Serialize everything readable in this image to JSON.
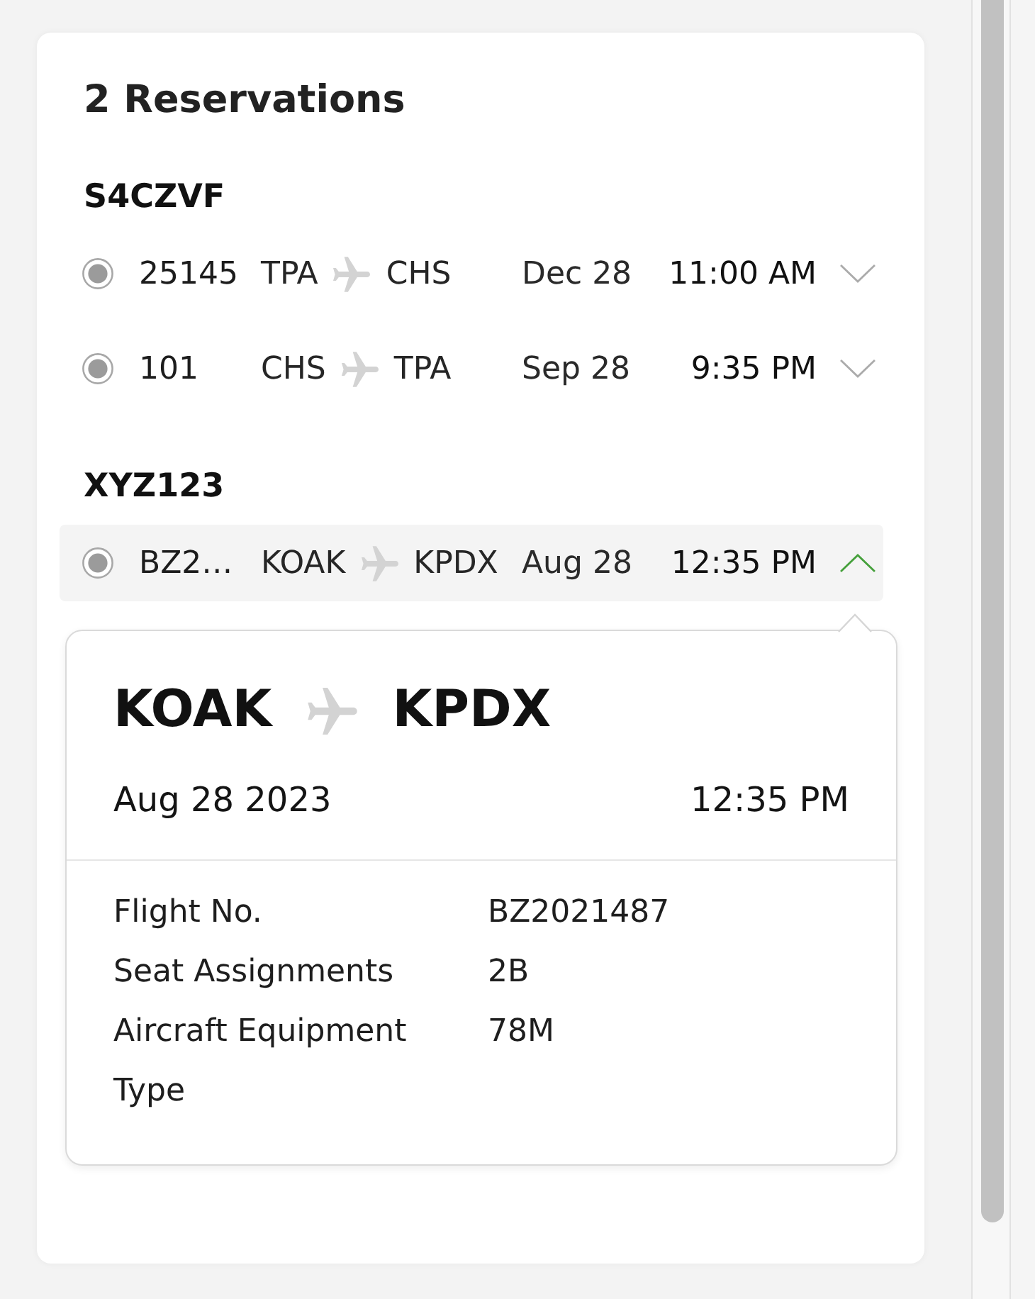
{
  "title": "2 Reservations",
  "reservations": [
    {
      "code": "S4CZVF",
      "flights": [
        {
          "flight_no": "25145",
          "origin": "TPA",
          "destination": "CHS",
          "date": "Dec 28",
          "time": "11:00 AM",
          "checked": true,
          "expanded": false
        },
        {
          "flight_no": "101",
          "origin": "CHS",
          "destination": "TPA",
          "date": "Sep 28",
          "time": "9:35 PM",
          "checked": true,
          "expanded": false
        }
      ]
    },
    {
      "code": "XYZ123",
      "flights": [
        {
          "flight_no": "BZ2…",
          "origin": "KOAK",
          "destination": "KPDX",
          "date": "Aug 28",
          "time": "12:35 PM",
          "checked": true,
          "expanded": true,
          "details": {
            "origin": "KOAK",
            "destination": "KPDX",
            "date": "Aug 28 2023",
            "time": "12:35 PM",
            "fields": [
              {
                "label": "Flight No.",
                "value": "BZ2021487"
              },
              {
                "label": "Seat Assignments",
                "value": "2B"
              },
              {
                "label": "Aircraft Equipment Type",
                "value": "78M"
              }
            ]
          }
        }
      ]
    }
  ]
}
